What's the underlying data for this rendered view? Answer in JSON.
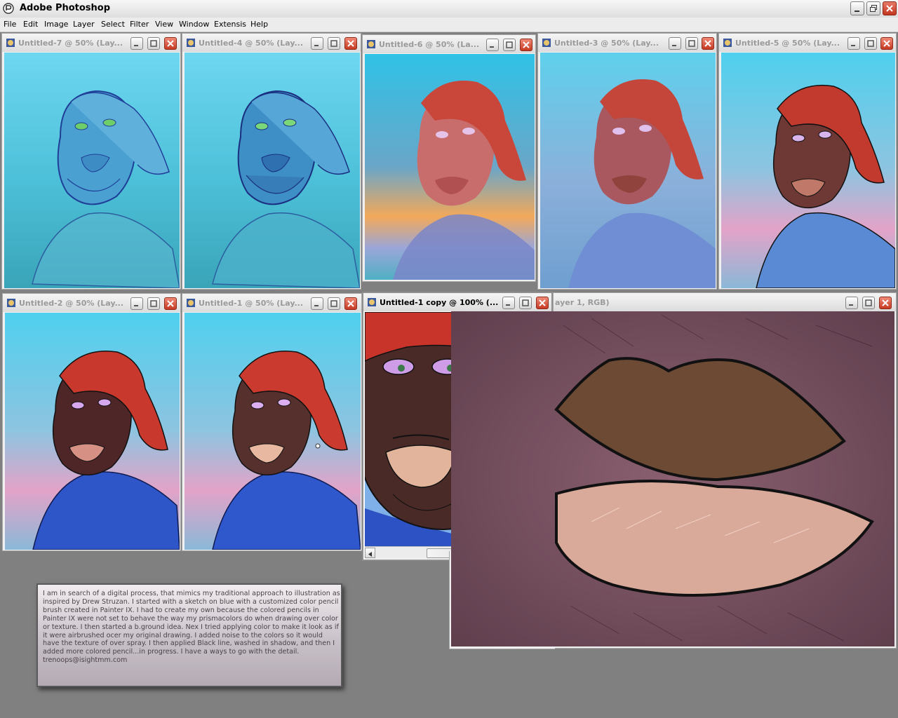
{
  "app": {
    "title": "Adobe Photoshop",
    "icon": "photoshop-app-icon"
  },
  "menu": [
    "File",
    "Edit",
    "Image",
    "Layer",
    "Select",
    "Filter",
    "View",
    "Window",
    "Extensis",
    "Help"
  ],
  "windows": {
    "w7": "Untitled-7 @ 50% (Lay...",
    "w4": "Untitled-4 @ 50% (Lay...",
    "w6": "Untitled-6 @ 50% (La...",
    "w3": "Untitled-3 @ 50% (Lay...",
    "w5": "Untitled-5 @ 50% (Lay...",
    "w2": "Untitled-2 @ 50% (Lay...",
    "w1": "Untitled-1 @ 50% (Lay...",
    "w1copy": "Untitled-1 copy @ 100% (...",
    "wlips": "ayer 1, RGB)"
  },
  "note": {
    "text": "I am in search of a digital process, that mimics my traditional approach to illustration as inspired by Drew Struzan. I started with a sketch on blue with a customized color pencil brush created in Painter IX. I had to create my own because the colored pencils in Painter IX were not set to behave the way my prismacolors do when drawing over color or texture. I then started a b.ground idea. Nex I tried applying color to make it look as if it were airbrushed ocer my original drawing. I added noise to the colors so it would have the texture of over spray. I then applied Black line, washed in shadow, and then I added more colored pencil...in progress. I have a ways to go with the detail.  trenoops@isightmm.com"
  },
  "colors": {
    "desktop": "#808080",
    "sky_top": "#5fd0ee",
    "sky_bottom": "#3aa9bf",
    "bandana": "#c8382c",
    "close_button": "#c63a22"
  }
}
